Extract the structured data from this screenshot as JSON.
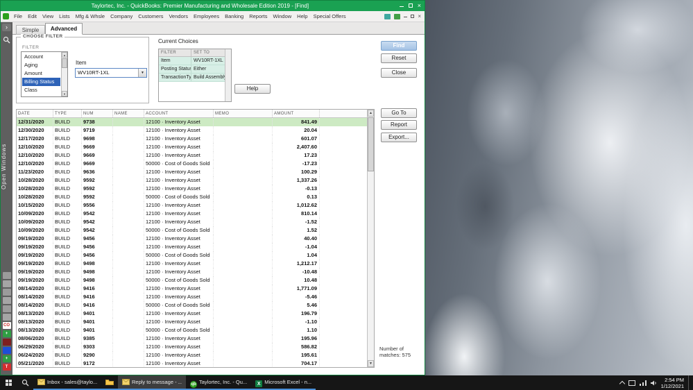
{
  "colors": {
    "titlebar_green": "#1aa152",
    "qb_brand_green": "#2ca01c",
    "result_selection_green": "#cdeac3",
    "filter_selection_blue": "#2e63b8",
    "current_choice_teal": "#d7efe6",
    "taskbar_accent_blue": "#4a90d9"
  },
  "icons": {
    "up_arrow": "▲",
    "down_arrow": "▼",
    "dropdown_arrow": "▼",
    "close_glyph": "×",
    "chevron_right": "›"
  },
  "window": {
    "title": "Taylortec, Inc. - QuickBooks: Premier Manufacturing and Wholesale Edition 2019 - [Find]",
    "menus": [
      "File",
      "Edit",
      "View",
      "Lists",
      "Mfg & Whsle",
      "Company",
      "Customers",
      "Vendors",
      "Employees",
      "Banking",
      "Reports",
      "Window",
      "Help",
      "Special Offers"
    ]
  },
  "open_windows_label": "Open Windows",
  "left_strip_icons": [
    {
      "name": "app-icon-1",
      "bg": "#9b9b9b",
      "fg": "#555",
      "label": ""
    },
    {
      "name": "app-icon-2",
      "bg": "#a5a5a5",
      "fg": "#555",
      "label": ""
    },
    {
      "name": "app-icon-3",
      "bg": "#9b9b9b",
      "fg": "#555",
      "label": ""
    },
    {
      "name": "app-icon-4",
      "bg": "#a5a5a5",
      "fg": "#555",
      "label": ""
    },
    {
      "name": "app-icon-5",
      "bg": "#9b9b9b",
      "fg": "#555",
      "label": ""
    },
    {
      "name": "app-icon-6",
      "bg": "#a5a5a5",
      "fg": "#555",
      "label": ""
    },
    {
      "name": "co-app-icon",
      "bg": "#ffffff",
      "fg": "#cc2222",
      "label": "CO"
    },
    {
      "name": "green-plus-icon-1",
      "bg": "#2f9e44",
      "fg": "#ffffff",
      "label": "+"
    },
    {
      "name": "maroon-app-icon",
      "bg": "#7e1f1f",
      "fg": "#ffffff",
      "label": ""
    },
    {
      "name": "blue-app-icon",
      "bg": "#1d4ed8",
      "fg": "#ffffff",
      "label": ""
    },
    {
      "name": "green-plus-icon-2",
      "bg": "#2f9e44",
      "fg": "#ffffff",
      "label": "+"
    },
    {
      "name": "red-t-icon",
      "bg": "#d32f2f",
      "fg": "#ffffff",
      "label": "T"
    }
  ],
  "find": {
    "tabs": {
      "simple": "Simple",
      "advanced": "Advanced"
    },
    "choose_filter": {
      "legend": "CHOOSE FILTER",
      "column_label": "FILTER",
      "options": [
        "Account",
        "Aging",
        "Amount",
        "Billing Status",
        "Class"
      ],
      "selected": "Billing Status",
      "item_label": "Item",
      "item_value": "WV10RT-1XL"
    },
    "current_choices": {
      "title": "Current Choices",
      "columns": [
        "FILTER",
        "SET TO"
      ],
      "rows": [
        [
          "Item",
          "WV10RT-1XL"
        ],
        [
          "Posting Status",
          "Either"
        ],
        [
          "TransactionType",
          "Build Assembly"
        ]
      ]
    },
    "buttons": {
      "find": "Find",
      "reset": "Reset",
      "close": "Close",
      "help": "Help",
      "go_to": "Go To",
      "report": "Report",
      "export": "Export..."
    },
    "results": {
      "columns": [
        "DATE",
        "TYPE",
        "NUM",
        "NAME",
        "ACCOUNT",
        "MEMO",
        "AMOUNT"
      ],
      "selected_row": 0,
      "matches_line1": "Number of",
      "matches_line2": "matches: 575",
      "rows": [
        [
          "12/31/2020",
          "BUILD",
          "9738",
          "",
          "12100 · Inventory Asset",
          "",
          "841.49"
        ],
        [
          "12/30/2020",
          "BUILD",
          "9719",
          "",
          "12100 · Inventory Asset",
          "",
          "20.04"
        ],
        [
          "12/17/2020",
          "BUILD",
          "9698",
          "",
          "12100 · Inventory Asset",
          "",
          "601.07"
        ],
        [
          "12/10/2020",
          "BUILD",
          "9669",
          "",
          "12100 · Inventory Asset",
          "",
          "2,407.60"
        ],
        [
          "12/10/2020",
          "BUILD",
          "9669",
          "",
          "12100 · Inventory Asset",
          "",
          "17.23"
        ],
        [
          "12/10/2020",
          "BUILD",
          "9669",
          "",
          "50000 · Cost of Goods Sold",
          "",
          "-17.23"
        ],
        [
          "11/23/2020",
          "BUILD",
          "9636",
          "",
          "12100 · Inventory Asset",
          "",
          "100.29"
        ],
        [
          "10/28/2020",
          "BUILD",
          "9592",
          "",
          "12100 · Inventory Asset",
          "",
          "1,337.26"
        ],
        [
          "10/28/2020",
          "BUILD",
          "9592",
          "",
          "12100 · Inventory Asset",
          "",
          "-0.13"
        ],
        [
          "10/28/2020",
          "BUILD",
          "9592",
          "",
          "50000 · Cost of Goods Sold",
          "",
          "0.13"
        ],
        [
          "10/15/2020",
          "BUILD",
          "9556",
          "",
          "12100 · Inventory Asset",
          "",
          "1,012.62"
        ],
        [
          "10/09/2020",
          "BUILD",
          "9542",
          "",
          "12100 · Inventory Asset",
          "",
          "810.14"
        ],
        [
          "10/09/2020",
          "BUILD",
          "9542",
          "",
          "12100 · Inventory Asset",
          "",
          "-1.52"
        ],
        [
          "10/09/2020",
          "BUILD",
          "9542",
          "",
          "50000 · Cost of Goods Sold",
          "",
          "1.52"
        ],
        [
          "09/19/2020",
          "BUILD",
          "9456",
          "",
          "12100 · Inventory Asset",
          "",
          "40.40"
        ],
        [
          "09/19/2020",
          "BUILD",
          "9456",
          "",
          "12100 · Inventory Asset",
          "",
          "-1.04"
        ],
        [
          "09/19/2020",
          "BUILD",
          "9456",
          "",
          "50000 · Cost of Goods Sold",
          "",
          "1.04"
        ],
        [
          "09/19/2020",
          "BUILD",
          "9498",
          "",
          "12100 · Inventory Asset",
          "",
          "1,212.17"
        ],
        [
          "09/19/2020",
          "BUILD",
          "9498",
          "",
          "12100 · Inventory Asset",
          "",
          "-10.48"
        ],
        [
          "09/19/2020",
          "BUILD",
          "9498",
          "",
          "50000 · Cost of Goods Sold",
          "",
          "10.48"
        ],
        [
          "08/14/2020",
          "BUILD",
          "9416",
          "",
          "12100 · Inventory Asset",
          "",
          "1,771.09"
        ],
        [
          "08/14/2020",
          "BUILD",
          "9416",
          "",
          "12100 · Inventory Asset",
          "",
          "-5.46"
        ],
        [
          "08/14/2020",
          "BUILD",
          "9416",
          "",
          "50000 · Cost of Goods Sold",
          "",
          "5.46"
        ],
        [
          "08/13/2020",
          "BUILD",
          "9401",
          "",
          "12100 · Inventory Asset",
          "",
          "196.79"
        ],
        [
          "08/13/2020",
          "BUILD",
          "9401",
          "",
          "12100 · Inventory Asset",
          "",
          "-1.10"
        ],
        [
          "08/13/2020",
          "BUILD",
          "9401",
          "",
          "50000 · Cost of Goods Sold",
          "",
          "1.10"
        ],
        [
          "08/06/2020",
          "BUILD",
          "9385",
          "",
          "12100 · Inventory Asset",
          "",
          "195.96"
        ],
        [
          "06/29/2020",
          "BUILD",
          "9303",
          "",
          "12100 · Inventory Asset",
          "",
          "586.82"
        ],
        [
          "06/24/2020",
          "BUILD",
          "9290",
          "",
          "12100 · Inventory Asset",
          "",
          "195.61"
        ],
        [
          "05/21/2020",
          "BUILD",
          "9172",
          "",
          "12100 · Inventory Asset",
          "",
          "704.17"
        ]
      ]
    }
  },
  "taskbar": {
    "items": [
      {
        "name": "taskbar-outlook-inbox",
        "icon": "mail",
        "label": "Inbox - sales@taylo...",
        "active": false
      },
      {
        "name": "taskbar-file-explorer",
        "icon": "folder",
        "label": "",
        "active": false
      },
      {
        "name": "taskbar-outlook-reply",
        "icon": "mail",
        "label": "Reply to message - ...",
        "active": true
      },
      {
        "name": "taskbar-quickbooks",
        "icon": "qb",
        "label": "Taylortec, Inc. - Qu...",
        "active": false
      },
      {
        "name": "taskbar-excel",
        "icon": "excel",
        "label": "Microsoft Excel - n...",
        "active": false
      }
    ],
    "tray": {
      "time": "2:54 PM",
      "date": "1/12/2021"
    }
  }
}
